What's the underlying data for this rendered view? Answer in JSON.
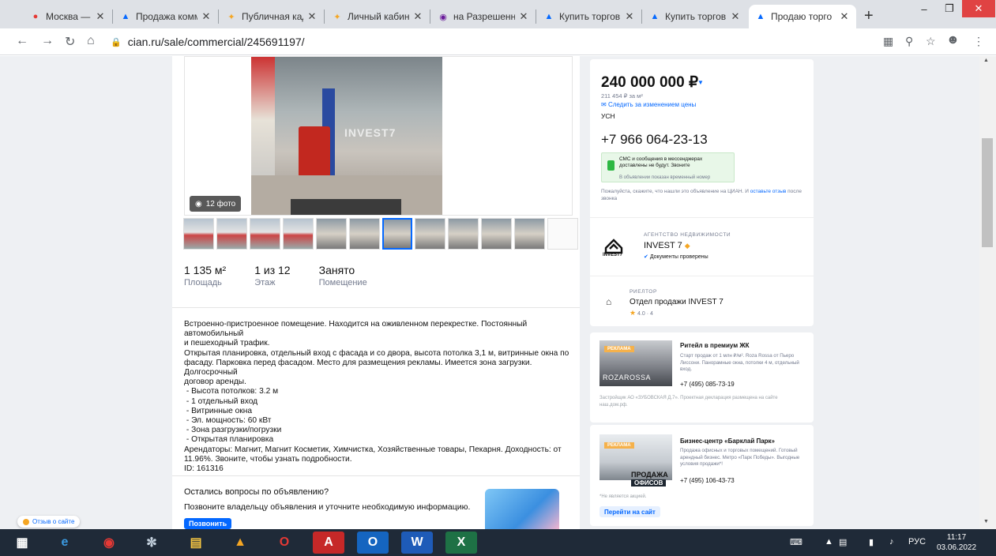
{
  "browser": {
    "tabs": [
      {
        "label": "Москва — Янд",
        "icon": "map-pin-icon",
        "color": "#e53935"
      },
      {
        "label": "Продажа комм",
        "icon": "cian-icon",
        "color": "#0468ff"
      },
      {
        "label": "Публичная кад",
        "icon": "map-icon",
        "color": "#f5a623"
      },
      {
        "label": "Личный кабин",
        "icon": "map-icon",
        "color": "#f5a623"
      },
      {
        "label": "на Разрешенн",
        "icon": "globe-icon",
        "color": "#6a1b9a"
      },
      {
        "label": "Купить торгов",
        "icon": "cian-icon",
        "color": "#0468ff"
      },
      {
        "label": "Купить торгов",
        "icon": "cian-icon",
        "color": "#0468ff"
      },
      {
        "label": "Продаю торго",
        "icon": "cian-icon",
        "color": "#0468ff"
      }
    ],
    "url": "cian.ru/sale/commercial/245691197/"
  },
  "listing": {
    "photo_count": "12 фото",
    "stats": [
      {
        "value": "1 135 м²",
        "label": "Площадь"
      },
      {
        "value": "1 из 12",
        "label": "Этаж"
      },
      {
        "value": "Занято",
        "label": "Помещение"
      }
    ],
    "description": [
      "Встроенно-пристроенное помещение. Находится на оживленном перекрестке. Постоянный автомобильный",
      "и пешеходный трафик.",
      "Открытая планировка, отдельный вход с фасада и со двора, высота потолка 3,1 м, витринные окна по",
      "фасаду. Парковка перед фасадом. Место для размещения рекламы. Имеется зона загрузки. Долгосрочный",
      "договор аренды.",
      " - Высота потолков: 3.2 м",
      " - 1 отдельный вход",
      " - Витринные окна",
      " - Эл. мощность: 60 кВт",
      " - Зона разгрузки/погрузки",
      " - Открытая планировка",
      "Арендаторы: Магнит, Магнит Косметик, Химчистка, Хозяйственные товары, Пекарня. Доходность: от",
      "11.96%. Звоните, чтобы узнать подробности.",
      "ID: 161316"
    ],
    "questions_title": "Остались вопросы по объявлению?",
    "questions_sub": "Позвоните владельцу объявления и уточните необходимую информацию.",
    "call_button": "Позвонить"
  },
  "sidebar": {
    "price": "240 000 000 ₽",
    "price_per_m2": "211 454 ₽ за м²",
    "watch_price": "Следить за изменением цены",
    "tax": "УСН",
    "phone": "+7 966 064-23-13",
    "sms_line1": "СМС и сообщения в мессенджерах",
    "sms_line2": "доставлены не будут. Звоните",
    "sms_line3": "В объявлении показан временный номер",
    "ask_text": "Пожалуйста, скажите, что нашли это объявление на ЦИАН. И ",
    "ask_link": "оставьте отзыв",
    "ask_tail": " после звонка",
    "agency_caption": "АГЕНТСТВО НЕДВИЖИМОСТИ",
    "agency_name": "INVEST 7",
    "agency_logo_text": "INVEST7",
    "agency_verified": "Документы проверены",
    "realtor_caption": "РИЕЛТОР",
    "realtor_name": "Отдел продажи INVEST 7",
    "realtor_rating": "4.0 · 4"
  },
  "ads": [
    {
      "badge": "РЕКЛАМА",
      "brand": "ROZAROSSA",
      "title": "Ритейл в премиум ЖК",
      "text": "Старт продаж от 1 млн ₽/м². Roza Rossa от Пьеро Лиссони. Панорамные окна, потолки 4 м, отдельный вход.",
      "phone": "+7 (495) 085-73-19",
      "footer": "Застройщик АО «ЗУБОВСКАЯ Д.7». Проектная декларация размещена на сайте наш.дом.рф."
    },
    {
      "badge": "РЕКЛАМА",
      "img_line1": "ПРОДАЖА",
      "img_line2": "ОФИСОВ",
      "title": "Бизнес-центр «Барклай Парк»",
      "text": "Продажа офисных и торговых помещений. Готовый арендный бизнес. Метро «Парк Победы». Выгодные условия продажи*!",
      "phone": "+7 (495) 106-43-73",
      "footer": "*Не является акцией.",
      "button": "Перейти на сайт"
    }
  ],
  "feedback": "Отзыв о сайте",
  "taskbar": {
    "lang": "РУС",
    "time": "11:17",
    "date": "03.06.2022"
  }
}
